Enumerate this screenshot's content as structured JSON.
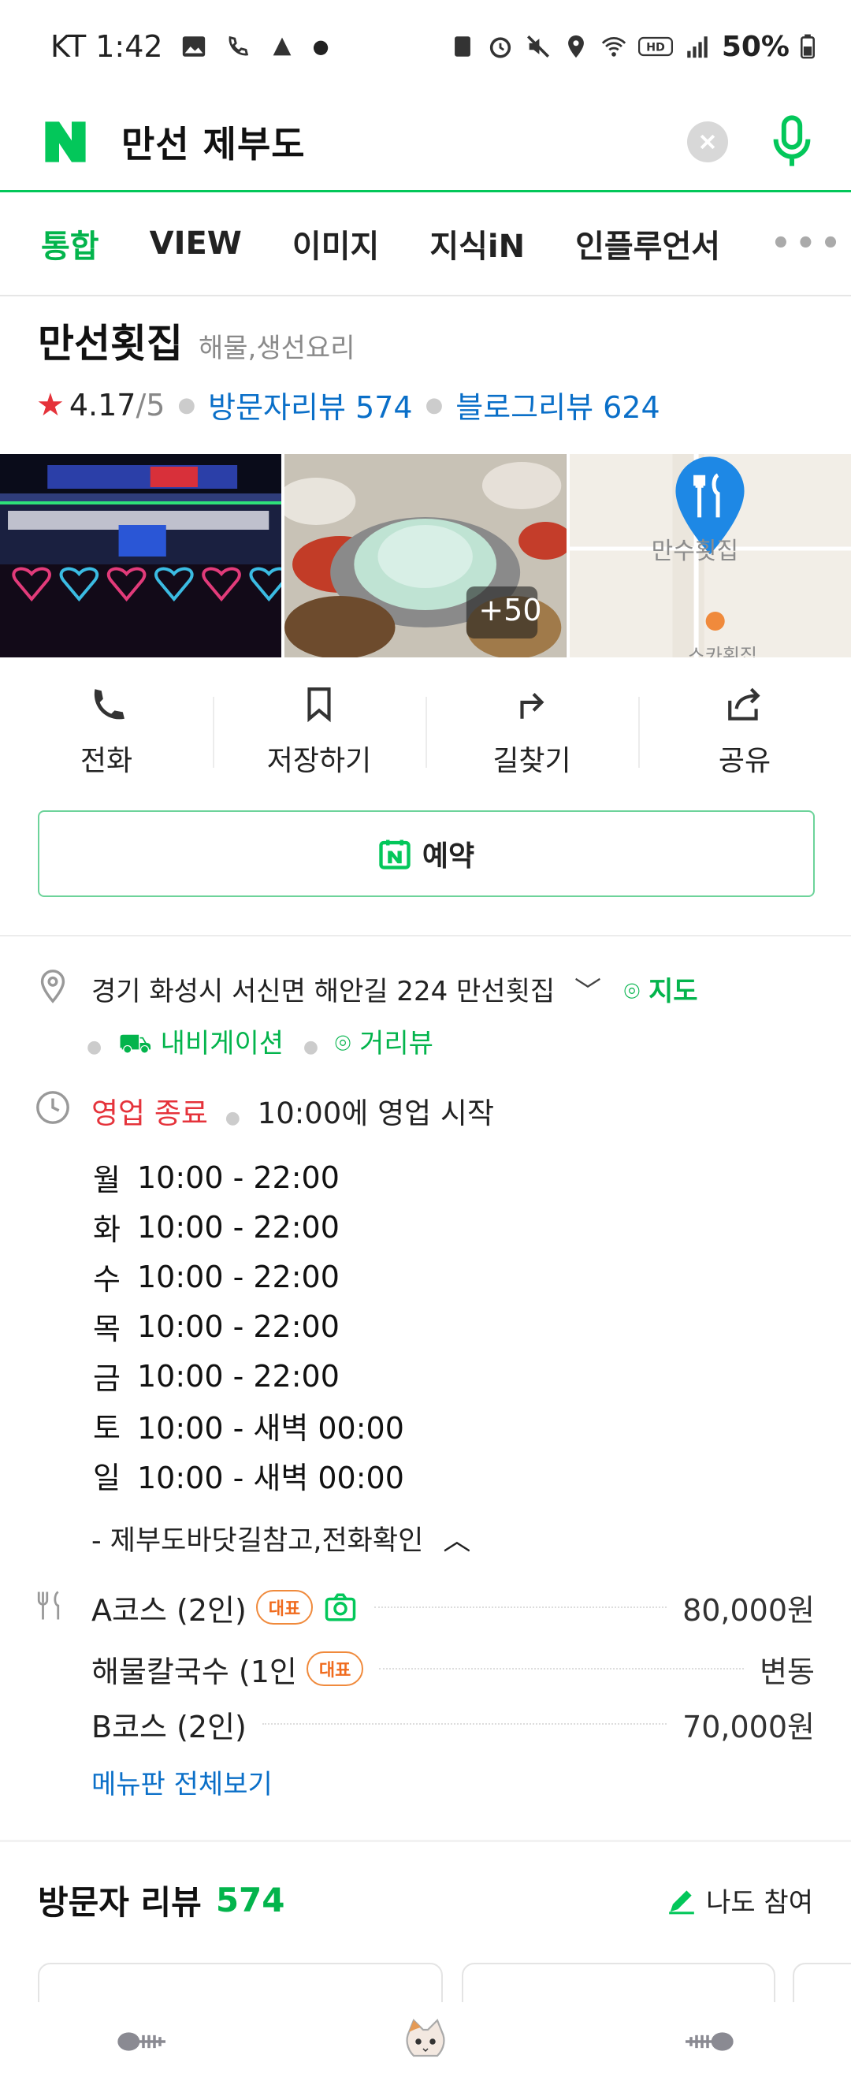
{
  "status_bar": {
    "carrier_time": "KT 1:42",
    "battery": "50%"
  },
  "search": {
    "query": "만선 제부도"
  },
  "tabs": [
    {
      "label": "통합",
      "active": true
    },
    {
      "label": "VIEW"
    },
    {
      "label": "이미지"
    },
    {
      "label": "지식iN"
    },
    {
      "label": "인플루언서"
    }
  ],
  "place": {
    "name": "만선횟집",
    "category": "해물,생선요리",
    "rating": "4.17",
    "rating_max": "/5",
    "visitor_reviews": "방문자리뷰 574",
    "blog_reviews": "블로그리뷰 624"
  },
  "photos": {
    "more_count": "+50",
    "map_label": "만수횟집",
    "map_label2": "스카횟집"
  },
  "actions": [
    {
      "label": "전화",
      "icon": "phone-icon"
    },
    {
      "label": "저장하기",
      "icon": "bookmark-icon"
    },
    {
      "label": "길찾기",
      "icon": "directions-icon"
    },
    {
      "label": "공유",
      "icon": "share-icon"
    }
  ],
  "reserve": {
    "label": "예약"
  },
  "address": {
    "text": "경기 화성시 서신면 해안길 224 만선횟집",
    "map_link": "지도",
    "navigation": "내비게이션",
    "street_view": "거리뷰"
  },
  "business": {
    "status": "영업 종료",
    "next_open": "10:00에 영업 시작",
    "hours": [
      {
        "day": "월",
        "time": "10:00 - 22:00"
      },
      {
        "day": "화",
        "time": "10:00 - 22:00"
      },
      {
        "day": "수",
        "time": "10:00 - 22:00"
      },
      {
        "day": "목",
        "time": "10:00 - 22:00"
      },
      {
        "day": "금",
        "time": "10:00 - 22:00"
      },
      {
        "day": "토",
        "time": "10:00 - 새벽 00:00"
      },
      {
        "day": "일",
        "time": "10:00 - 새벽 00:00"
      }
    ],
    "note": "- 제부도바닷길참고,전화확인"
  },
  "menu": {
    "items": [
      {
        "name": "A코스 (2인)",
        "badge": "대표",
        "price": "80,000원"
      },
      {
        "name": "해물칼국수 (1인",
        "badge": "대표",
        "price": "변동"
      },
      {
        "name": "B코스 (2인)",
        "price": "70,000원"
      }
    ],
    "view_all": "메뉴판 전체보기"
  },
  "reviews": {
    "title": "방문자 리뷰",
    "count": "574",
    "join": "나도 참여"
  },
  "colors": {
    "naver_green": "#03c75a",
    "link_blue": "#0a6fc8",
    "alert_red": "#e5333b",
    "badge_orange": "#f06b1e"
  }
}
